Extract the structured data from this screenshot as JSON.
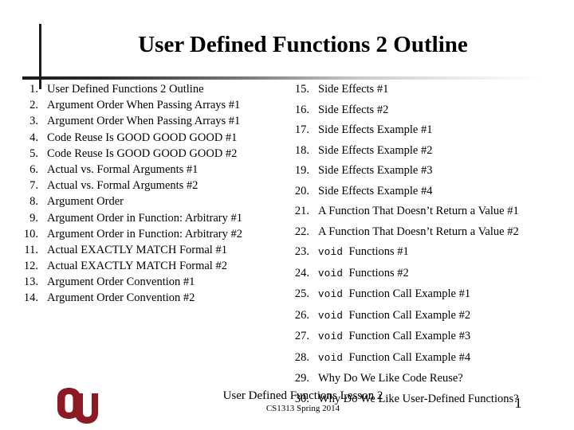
{
  "slide": {
    "title": "User Defined Functions 2 Outline",
    "background_color": "#ffffff",
    "text_color": "#000000",
    "rule_color": "#1a1a1a"
  },
  "outline": {
    "left_column": [
      {
        "number": "1.",
        "text": "User Defined Functions 2 Outline"
      },
      {
        "number": "2.",
        "text": "Argument Order When Passing Arrays #1"
      },
      {
        "number": "3.",
        "text": "Argument Order When Passing Arrays #1"
      },
      {
        "number": "4.",
        "text": "Code Reuse Is GOOD GOOD GOOD #1"
      },
      {
        "number": "5.",
        "text": "Code Reuse Is GOOD GOOD GOOD #2"
      },
      {
        "number": "6.",
        "text": "Actual vs. Formal Arguments #1"
      },
      {
        "number": "7.",
        "text": "Actual vs. Formal Arguments #2"
      },
      {
        "number": "8.",
        "text": "Argument Order"
      },
      {
        "number": "9.",
        "text": "Argument Order in Function: Arbitrary #1"
      },
      {
        "number": "10.",
        "text": "Argument Order in Function: Arbitrary #2"
      },
      {
        "number": "11.",
        "text": "Actual EXACTLY MATCH Formal #1"
      },
      {
        "number": "12.",
        "text": "Actual EXACTLY MATCH Formal #2"
      },
      {
        "number": "13.",
        "text": "Argument Order Convention #1"
      },
      {
        "number": "14.",
        "text": "Argument Order Convention #2"
      }
    ],
    "right_column": [
      {
        "number": "15.",
        "keyword": "",
        "text": "Side Effects #1"
      },
      {
        "number": "16.",
        "keyword": "",
        "text": "Side Effects #2"
      },
      {
        "number": "17.",
        "keyword": "",
        "text": "Side Effects Example #1"
      },
      {
        "number": "18.",
        "keyword": "",
        "text": "Side Effects Example #2"
      },
      {
        "number": "19.",
        "keyword": "",
        "text": "Side Effects Example #3"
      },
      {
        "number": "20.",
        "keyword": "",
        "text": "Side Effects Example #4"
      },
      {
        "number": "21.",
        "keyword": "",
        "text": "A Function That Doesn’t Return a Value #1"
      },
      {
        "number": "22.",
        "keyword": "",
        "text": "A Function That Doesn’t Return a Value #2"
      },
      {
        "number": "23.",
        "keyword": "void",
        "text": "Functions #1"
      },
      {
        "number": "24.",
        "keyword": "void",
        "text": "Functions #2"
      },
      {
        "number": "25.",
        "keyword": "void",
        "text": "Function Call Example #1"
      },
      {
        "number": "26.",
        "keyword": "void",
        "text": "Function Call Example #2"
      },
      {
        "number": "27.",
        "keyword": "void",
        "text": "Function Call Example #3"
      },
      {
        "number": "28.",
        "keyword": "void",
        "text": "Function Call Example #4"
      },
      {
        "number": "29.",
        "keyword": "",
        "text": "Why Do We Like Code Reuse?"
      },
      {
        "number": "30.",
        "keyword": "",
        "text": "Why Do We Like User-Defined Functions?"
      }
    ]
  },
  "footer": {
    "line1": "User Defined Functions Lesson 2",
    "line2": "CS1313 Spring 2014",
    "page_number": "1",
    "logo_name": "ou-logo",
    "logo_color": "#8B1A23"
  }
}
